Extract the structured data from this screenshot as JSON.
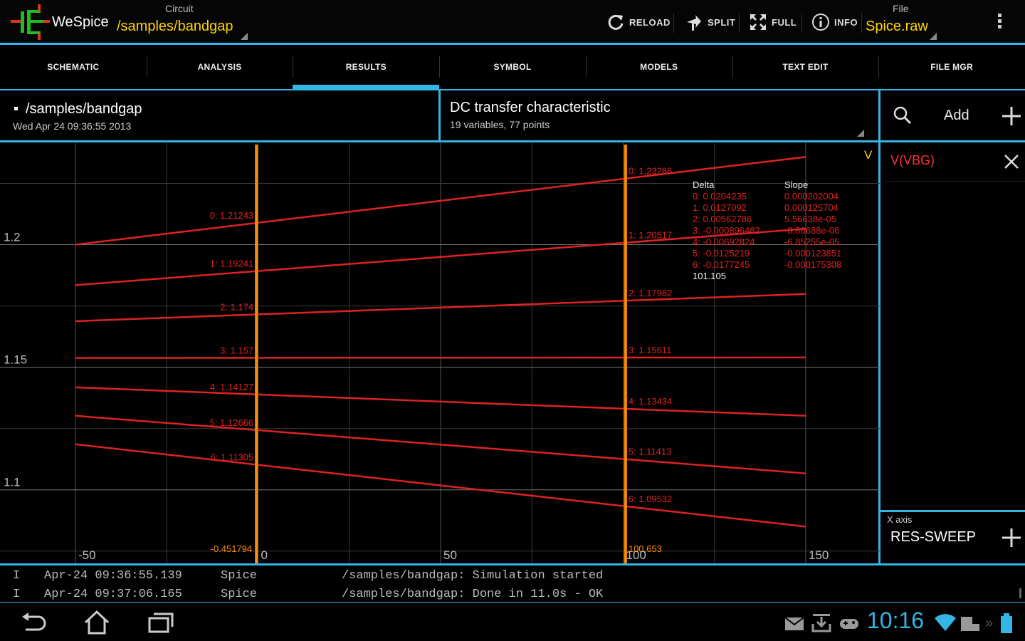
{
  "app": {
    "title": "WeSpice"
  },
  "circuit": {
    "label": "Circuit",
    "value": "/samples/bandgap"
  },
  "file": {
    "label": "File",
    "value": "Spice.raw"
  },
  "actions": {
    "reload": "RELOAD",
    "split": "SPLIT",
    "full": "FULL",
    "info": "INFO"
  },
  "tabs": [
    "SCHEMATIC",
    "ANALYSIS",
    "RESULTS",
    "SYMBOL",
    "MODELS",
    "TEXT EDIT",
    "FILE MGR"
  ],
  "active_tab": "RESULTS",
  "results": {
    "circuit_name": "/samples/bandgap",
    "date": "Wed Apr 24 09:36:55 2013",
    "analysis_title": "DC transfer characteristic",
    "analysis_sub": "19 variables, 77 points",
    "add_label": "Add",
    "trace_name": "V(VBG)",
    "xaxis_label": "X axis",
    "xaxis_value": "RES-SWEEP"
  },
  "colors": {
    "accent": "#33b5e5",
    "trace": "#dd2222",
    "cursor": "#ff8c00",
    "highlight": "#ffd400"
  },
  "chart_data": {
    "type": "line",
    "x": [
      -50,
      150
    ],
    "xlim": [
      -50,
      150
    ],
    "ylim": [
      1.07,
      1.242
    ],
    "y_unit": "V",
    "xticks": [
      -50,
      0,
      50,
      100,
      150
    ],
    "yticks": [
      1.1,
      1.15,
      1.2
    ],
    "grid": true,
    "series": [
      {
        "name": "0",
        "values": [
          1.2,
          1.2358
        ]
      },
      {
        "name": "1",
        "values": [
          1.1835,
          1.2065
        ]
      },
      {
        "name": "2",
        "values": [
          1.1688,
          1.1799
        ]
      },
      {
        "name": "3",
        "values": [
          1.1538,
          1.154
        ]
      },
      {
        "name": "4",
        "values": [
          1.1418,
          1.1302
        ]
      },
      {
        "name": "5",
        "values": [
          1.1302,
          1.1067
        ]
      },
      {
        "name": "6",
        "values": [
          1.1186,
          1.085
        ]
      }
    ],
    "cursors": [
      {
        "x": -0.451794,
        "label": "-0.451794",
        "values": [
          "0: 1.21243",
          "1: 1.19241",
          "2: 1.174",
          "3: 1.157",
          "4: 1.14127",
          "5: 1.12666",
          "6: 1.11305"
        ]
      },
      {
        "x": 100.653,
        "label": "100.653",
        "values": [
          "0: 1.23286",
          "1: 1.20517",
          "2: 1.17962",
          "3: 1.15611",
          "4: 1.13434",
          "5: 1.11413",
          "6: 1.09532"
        ]
      }
    ],
    "delta_header": "Delta",
    "slope_header": "Slope",
    "delta": [
      "0: 0.0204235",
      "1: 0.0127092",
      "2: 0.00562786",
      "3: -0.000896482",
      "4: -0.00692824",
      "5: -0.0125219",
      "6: -0.0177245"
    ],
    "slope": [
      "0.000202004",
      "0.000125704",
      "5.56638e-05",
      "-8.86688e-06",
      "-6.85255e-05",
      "-0.000123851",
      "-0.000175308"
    ],
    "x_delta": "101.105"
  },
  "log": [
    {
      "level": "I",
      "time": "Apr-24 09:36:55.139",
      "source": "Spice",
      "message": "/samples/bandgap: Simulation started"
    },
    {
      "level": "I",
      "time": "Apr-24 09:37:06.165",
      "source": "Spice",
      "message": "/samples/bandgap: Done in 11.0s - OK"
    }
  ],
  "status": {
    "time": "10:16"
  },
  "icons": [
    "reload-icon",
    "split-icon",
    "full-icon",
    "info-icon",
    "search-icon",
    "add-icon",
    "close-icon",
    "back-icon",
    "home-icon",
    "recents-icon",
    "mail-icon",
    "download-icon",
    "gamepad-icon",
    "wifi-icon",
    "battery-icon"
  ]
}
